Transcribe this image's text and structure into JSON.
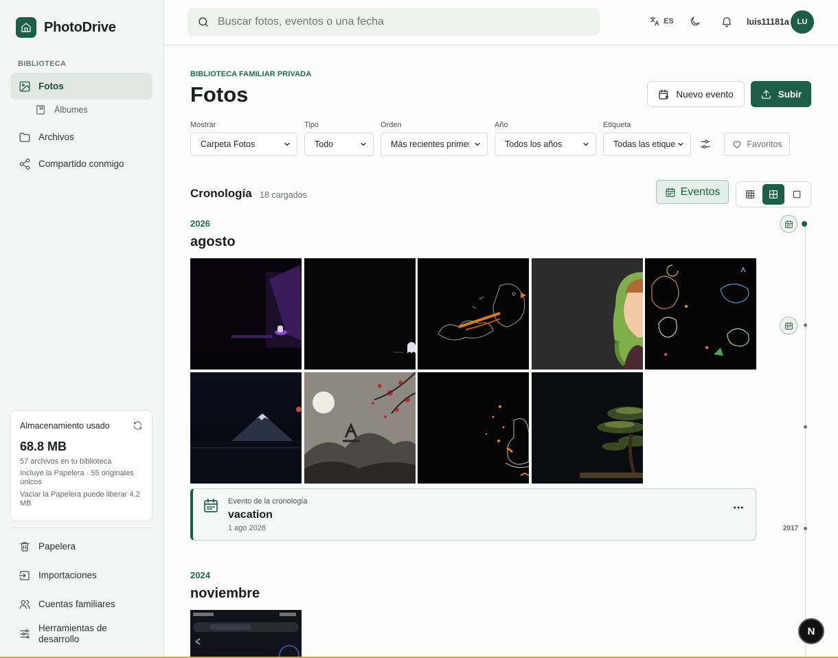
{
  "app": {
    "name": "PhotoDrive",
    "user": "luis11181a",
    "avatar_initials": "LU",
    "language": "ES",
    "accent": "#1d5e48"
  },
  "sidebar": {
    "section_label": "BIBLIOTECA",
    "primary": [
      {
        "label": "Fotos",
        "icon": "image-icon"
      },
      {
        "label": "Álbumes",
        "icon": "album-icon"
      },
      {
        "label": "Archivos",
        "icon": "folder-icon"
      },
      {
        "label": "Compartido conmigo",
        "icon": "share-icon"
      }
    ],
    "secondary": [
      {
        "label": "Papelera",
        "icon": "trash-icon"
      },
      {
        "label": "Importaciones",
        "icon": "import-icon"
      },
      {
        "label": "Cuentas familiares",
        "icon": "users-icon"
      },
      {
        "label": "Herramientas de desarrollo",
        "icon": "sliders-icon"
      }
    ],
    "storage": {
      "title": "Almacenamiento usado",
      "amount": "68.8 MB",
      "line1": "57 archivos en tu biblioteca",
      "line2": "Incluye la Papelera · 55 originales únicos",
      "line3": "Vaciar la Papelera puede liberar 4.2 MB"
    }
  },
  "topbar": {
    "search_placeholder": "Buscar fotos, eventos o una fecha"
  },
  "header": {
    "eyebrow": "BIBLIOTECA FAMILIAR PRIVADA",
    "title": "Fotos",
    "new_event": "Nuevo evento",
    "upload": "Subir"
  },
  "filters": [
    {
      "label": "Mostrar",
      "value": "Carpeta Fotos"
    },
    {
      "label": "Tipo",
      "value": "Todo"
    },
    {
      "label": "Orden",
      "value": "Más recientes primero"
    },
    {
      "label": "Año",
      "value": "Todos los años"
    },
    {
      "label": "Etiqueta",
      "value": "Todas las etiquetas"
    }
  ],
  "favorites_label": "Favoritos",
  "timeline": {
    "title": "Cronología",
    "count": "18 cargados",
    "events_toggle": "Eventos",
    "groups": [
      {
        "year": "2026",
        "month": "agosto",
        "photo_count": 9
      },
      {
        "year": "2024",
        "month": "noviembre",
        "photo_count": 1
      }
    ],
    "event": {
      "kind": "Evento de la cronología",
      "name": "vacation",
      "date": "1 ago 2026"
    },
    "rail_year": "2017"
  },
  "dev_badge": "N"
}
